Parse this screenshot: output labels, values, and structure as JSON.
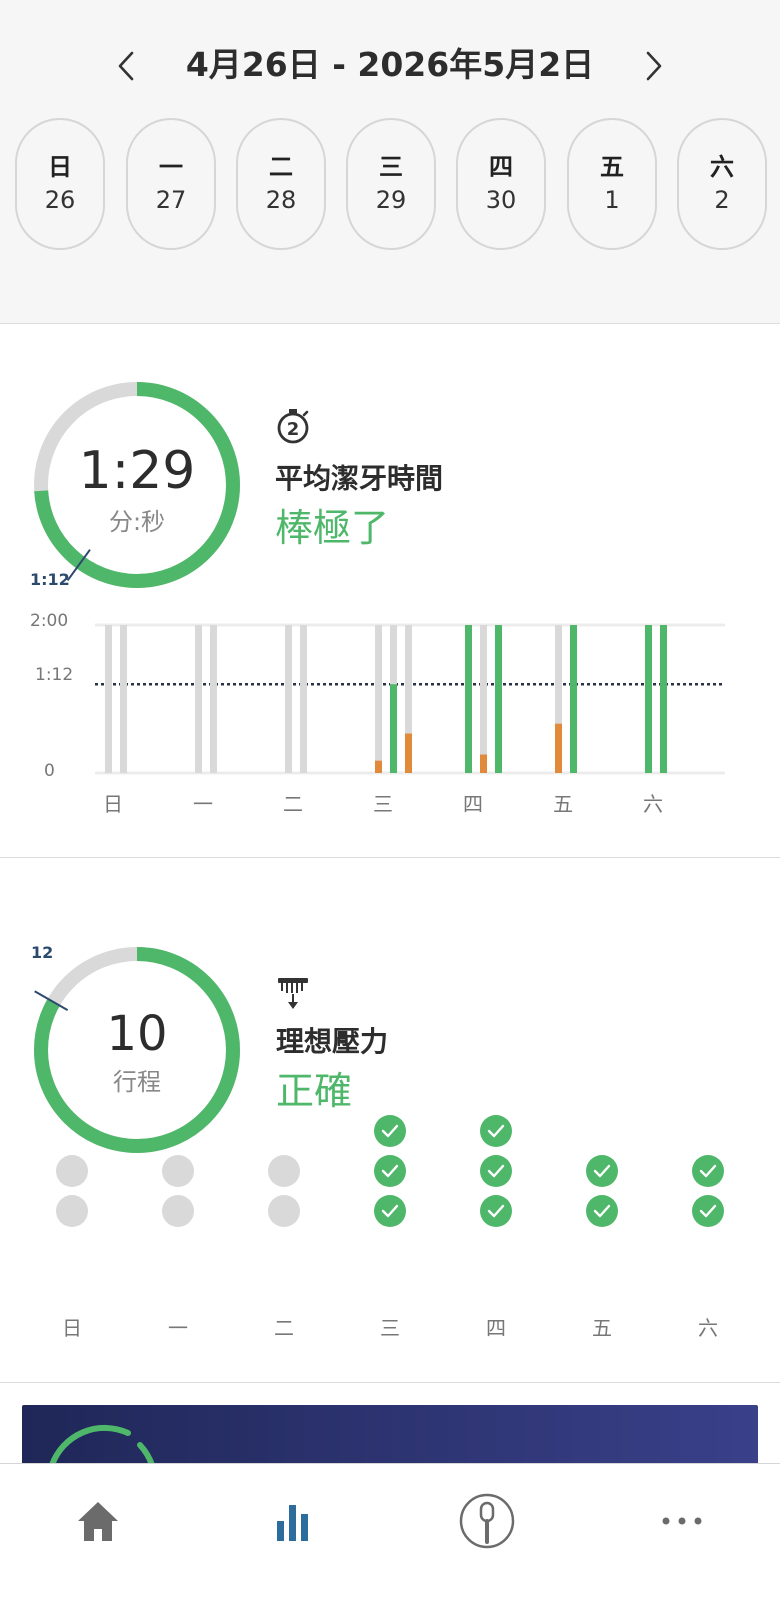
{
  "header": {
    "date_range": "4月26日 - 2026年5月2日",
    "prev_icon": "chevron-left-icon",
    "next_icon": "chevron-right-icon"
  },
  "days": [
    {
      "weekday": "日",
      "date": "26"
    },
    {
      "weekday": "一",
      "date": "27"
    },
    {
      "weekday": "二",
      "date": "28"
    },
    {
      "weekday": "三",
      "date": "29"
    },
    {
      "weekday": "四",
      "date": "30"
    },
    {
      "weekday": "五",
      "date": "1"
    },
    {
      "weekday": "六",
      "date": "2"
    }
  ],
  "brushing_time": {
    "value": "1:29",
    "unit": "分:秒",
    "target_label": "1:12",
    "title": "平均潔牙時間",
    "status": "棒極了",
    "icon": "stopwatch-icon",
    "icon_number": "2",
    "ring_progress": 0.74,
    "target_fraction": 0.6
  },
  "chart_data": {
    "type": "bar",
    "categories": [
      "日",
      "一",
      "二",
      "三",
      "四",
      "五",
      "六"
    ],
    "y_ticks": [
      "2:00",
      "1:12",
      "0"
    ],
    "ylim": [
      0,
      120
    ],
    "target_seconds": 72,
    "series_units": "seconds",
    "sessions": [
      [
        0,
        0
      ],
      [
        0,
        0
      ],
      [
        0,
        0
      ],
      [
        10,
        72,
        32
      ],
      [
        120,
        15,
        120
      ],
      [
        40,
        120
      ],
      [
        120,
        120
      ]
    ]
  },
  "pressure": {
    "value": "10",
    "unit": "行程",
    "target_label": "12",
    "title": "理想壓力",
    "status": "正確",
    "icon": "brush-pressure-icon",
    "ring_progress": 0.833,
    "target_fraction": 0.833,
    "weekdays": [
      "日",
      "一",
      "二",
      "三",
      "四",
      "五",
      "六"
    ],
    "checks": [
      [
        "miss",
        "miss"
      ],
      [
        "miss",
        "miss"
      ],
      [
        "miss",
        "miss"
      ],
      [
        "ok",
        "ok",
        "ok"
      ],
      [
        "ok",
        "ok",
        "ok"
      ],
      [
        "ok",
        "ok"
      ],
      [
        "ok",
        "ok"
      ]
    ]
  },
  "tabs": [
    {
      "name": "home",
      "icon": "home-icon"
    },
    {
      "name": "stats",
      "icon": "bar-chart-icon"
    },
    {
      "name": "brush",
      "icon": "toothbrush-head-icon"
    },
    {
      "name": "more",
      "icon": "more-dots-icon"
    }
  ],
  "colors": {
    "green": "#4fb76a",
    "grey_track": "#d9d9d9",
    "orange": "#e28a3c",
    "navy": "#2c4a6e",
    "tab_active": "#2d6d9e",
    "tab_inactive": "#6b6b6b"
  }
}
